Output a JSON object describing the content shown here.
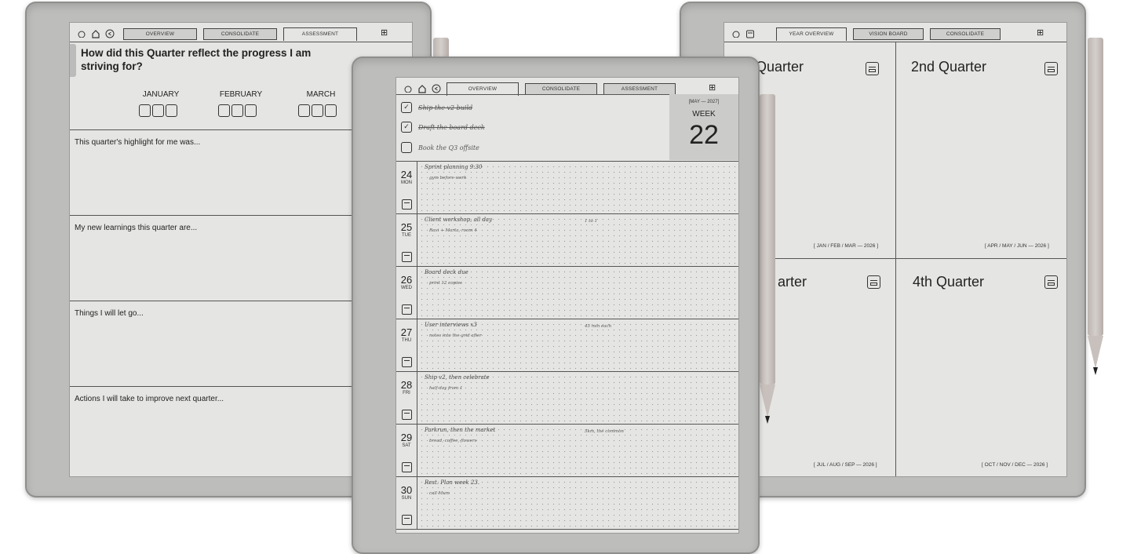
{
  "left_device": {
    "tabs": [
      "OVERVIEW",
      "CONSOLIDATE",
      "ASSESSMENT"
    ],
    "question": "How did this Quarter reflect the progress I am striving for?",
    "months": [
      "JANUARY",
      "FEBRUARY",
      "MARCH"
    ],
    "sections": [
      "This quarter's highlight for me was...",
      "My new learnings this quarter are...",
      "Things I will let go...",
      "Actions I will take to improve next quarter..."
    ]
  },
  "center_device": {
    "tabs": [
      "OVERVIEW",
      "CONSOLIDATE",
      "ASSESSMENT"
    ],
    "tasks": [
      {
        "text": "Ship the v2 build",
        "done": true
      },
      {
        "text": "Draft the board deck",
        "done": true
      },
      {
        "text": "Book the Q3 offsite",
        "done": false
      }
    ],
    "week": {
      "range": "[MAY — 2027]",
      "label": "WEEK",
      "number": "22"
    },
    "days": [
      {
        "num": "24",
        "name": "MON",
        "note1": "Sprint planning 9:30",
        "note2": "gym before work",
        "note3": ""
      },
      {
        "num": "25",
        "name": "TUE",
        "note1": "Client workshop, all day",
        "note2": "Ravi + Marta, room 4",
        "note3": "1 to 1"
      },
      {
        "num": "26",
        "name": "WED",
        "note1": "Board deck due",
        "note2": "print 12 copies",
        "note3": ""
      },
      {
        "num": "27",
        "name": "THU",
        "note1": "User interviews x3",
        "note2": "notes into the grid after",
        "note3": "45 min each"
      },
      {
        "num": "28",
        "name": "FRI",
        "note1": "Ship v2, then celebrate",
        "note2": "half day from 1",
        "note3": ""
      },
      {
        "num": "29",
        "name": "SAT",
        "note1": "Parkrun, then the market",
        "note2": "bread, coffee, flowers",
        "note3": "5km, the common"
      },
      {
        "num": "30",
        "name": "SUN",
        "note1": "Rest. Plan week 23.",
        "note2": "call Mum",
        "note3": ""
      }
    ]
  },
  "right_device": {
    "tabs": [
      "YEAR OVERVIEW",
      "VISION BOARD",
      "CONSOLIDATE"
    ],
    "quarters": [
      {
        "title": "Quarter",
        "range": "[ JAN / FEB / MAR — 2026 ]"
      },
      {
        "title": "2nd Quarter",
        "range": "[ APR / MAY / JUN — 2026 ]"
      },
      {
        "title": "arter",
        "range": "[ JUL / AUG / SEP — 2026 ]"
      },
      {
        "title": "4th Quarter",
        "range": "[ OCT / NOV / DEC — 2026 ]"
      }
    ]
  }
}
